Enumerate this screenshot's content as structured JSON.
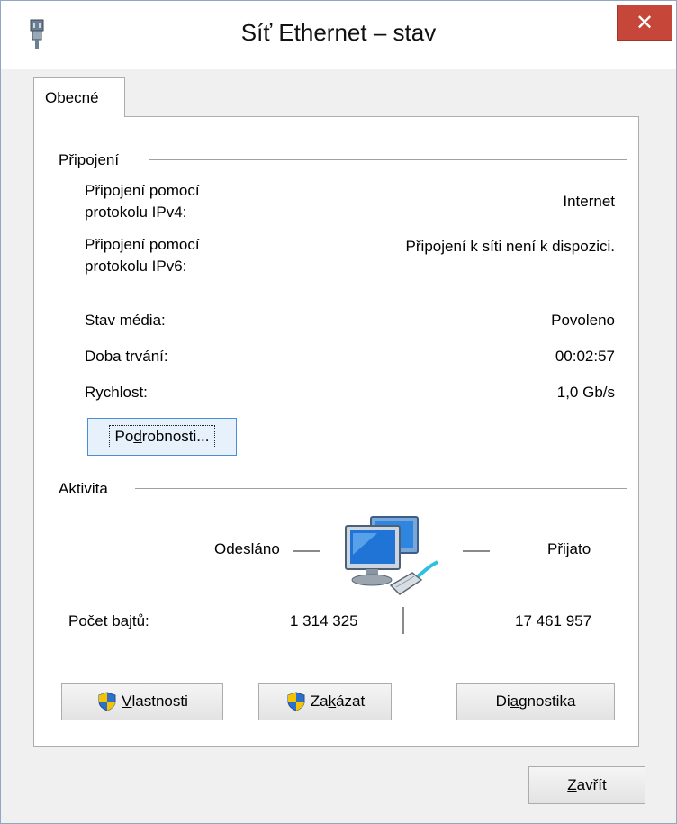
{
  "window": {
    "title": "Síť Ethernet – stav",
    "close_glyph": "✕"
  },
  "tabs": [
    {
      "label": "Obecné"
    }
  ],
  "connection": {
    "group_label": "Připojení",
    "ipv4_label_line1": "Připojení pomocí",
    "ipv4_label_line2": "protokolu IPv4:",
    "ipv4_value": "Internet",
    "ipv6_label_line1": "Připojení pomocí",
    "ipv6_label_line2": "protokolu IPv6:",
    "ipv6_value": "Připojení k síti není k dispozici.",
    "media_state_label": "Stav média:",
    "media_state_value": "Povoleno",
    "duration_label": "Doba trvání:",
    "duration_value": "00:02:57",
    "speed_label": "Rychlost:",
    "speed_value": "1,0 Gb/s",
    "details_button": {
      "pre": "Po",
      "key": "d",
      "post": "robnosti..."
    }
  },
  "activity": {
    "group_label": "Aktivita",
    "sent_label": "Odesláno",
    "received_label": "Přijato",
    "bytes_label": "Počet bajtů:",
    "bytes_sent": "1 314 325",
    "bytes_received": "17 461 957"
  },
  "buttons": {
    "properties": {
      "key": "V",
      "post": "lastnosti"
    },
    "disable": {
      "pre": "Za",
      "key": "k",
      "post": "ázat"
    },
    "diagnose": {
      "pre": "Di",
      "key": "a",
      "post": "gnostika"
    },
    "close": {
      "key": "Z",
      "post": "avřít"
    }
  },
  "colors": {
    "close_button": "#c7463a",
    "focus_border": "#4a8fd6",
    "shield_blue": "#2f6fc9",
    "shield_yellow": "#f5c400"
  },
  "icons": {
    "app": "network-adapter-icon",
    "activity": "network-computers-icon",
    "shield": "uac-shield-icon"
  }
}
